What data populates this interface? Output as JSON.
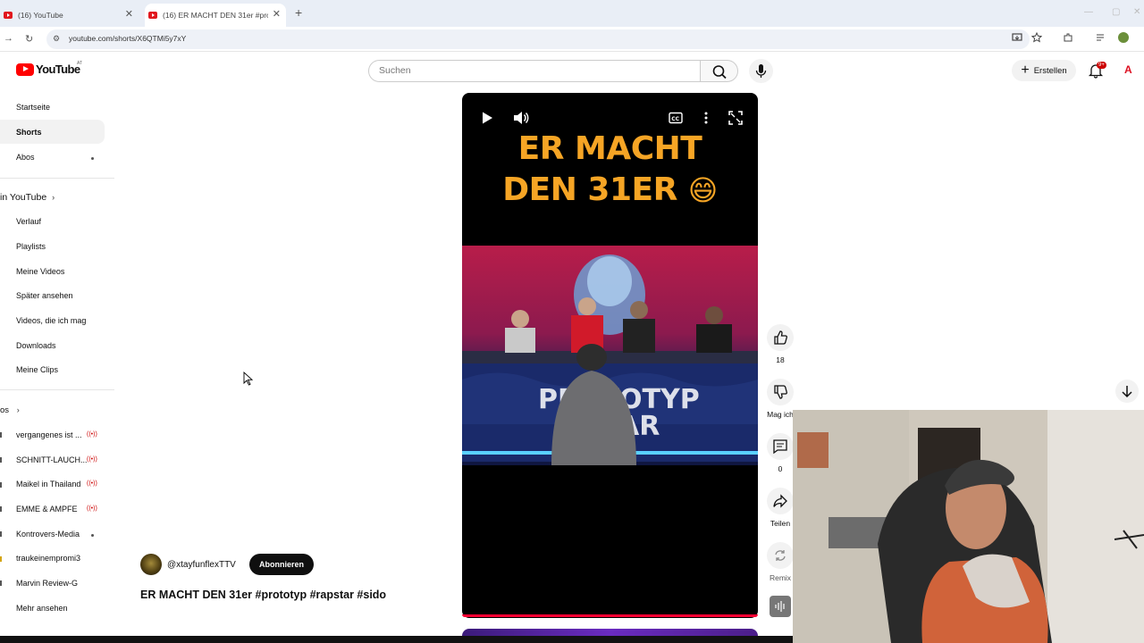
{
  "browser": {
    "tabs": [
      {
        "label": "(16) YouTube"
      },
      {
        "label": "(16) ER MACHT DEN 31er #prot"
      }
    ],
    "url": "youtube.com/shorts/X6QTMi5y7xY"
  },
  "header": {
    "logo_text": "YouTube",
    "region": "AT",
    "search_placeholder": "Suchen",
    "create_label": "Erstellen",
    "notification_count": "9+",
    "avatar_letter": "A"
  },
  "sidebar": {
    "main": [
      {
        "label": "Startseite"
      },
      {
        "label": "Shorts"
      },
      {
        "label": "Abos"
      }
    ],
    "you_heading": "in YouTube",
    "you_items": [
      {
        "label": "Verlauf"
      },
      {
        "label": "Playlists"
      },
      {
        "label": "Meine Videos"
      },
      {
        "label": "Später ansehen"
      },
      {
        "label": "Videos, die ich mag"
      },
      {
        "label": "Downloads"
      },
      {
        "label": "Meine Clips"
      }
    ],
    "subs_heading": "os",
    "subscriptions": [
      {
        "label": "vergangenes ist ..."
      },
      {
        "label": "SCHNITT-LAUCH..."
      },
      {
        "label": "Maikel in Thailand"
      },
      {
        "label": "EMME & AMPFE"
      },
      {
        "label": "Kontrovers-Media"
      },
      {
        "label": "traukeinempromi3"
      },
      {
        "label": "Marvin Review-G"
      },
      {
        "label": "Mehr ansehen"
      }
    ]
  },
  "video": {
    "headline_line1": "ER MACHT",
    "headline_line2": "DEN 31ER",
    "emoji": "😄",
    "title": "ER MACHT DEN 31er #prototyp #rapstar #sido",
    "channel": "@xtayfunflexTTV",
    "subscribe_label": "Abonnieren"
  },
  "actions": {
    "likes": "18",
    "dislike_label": "Mag ich",
    "comments": "0",
    "share_label": "Teilen",
    "remix_label": "Remix"
  },
  "colors": {
    "youtube_red": "#ff0000",
    "headline_orange": "#f6a525",
    "live_red": "#cc0000"
  }
}
